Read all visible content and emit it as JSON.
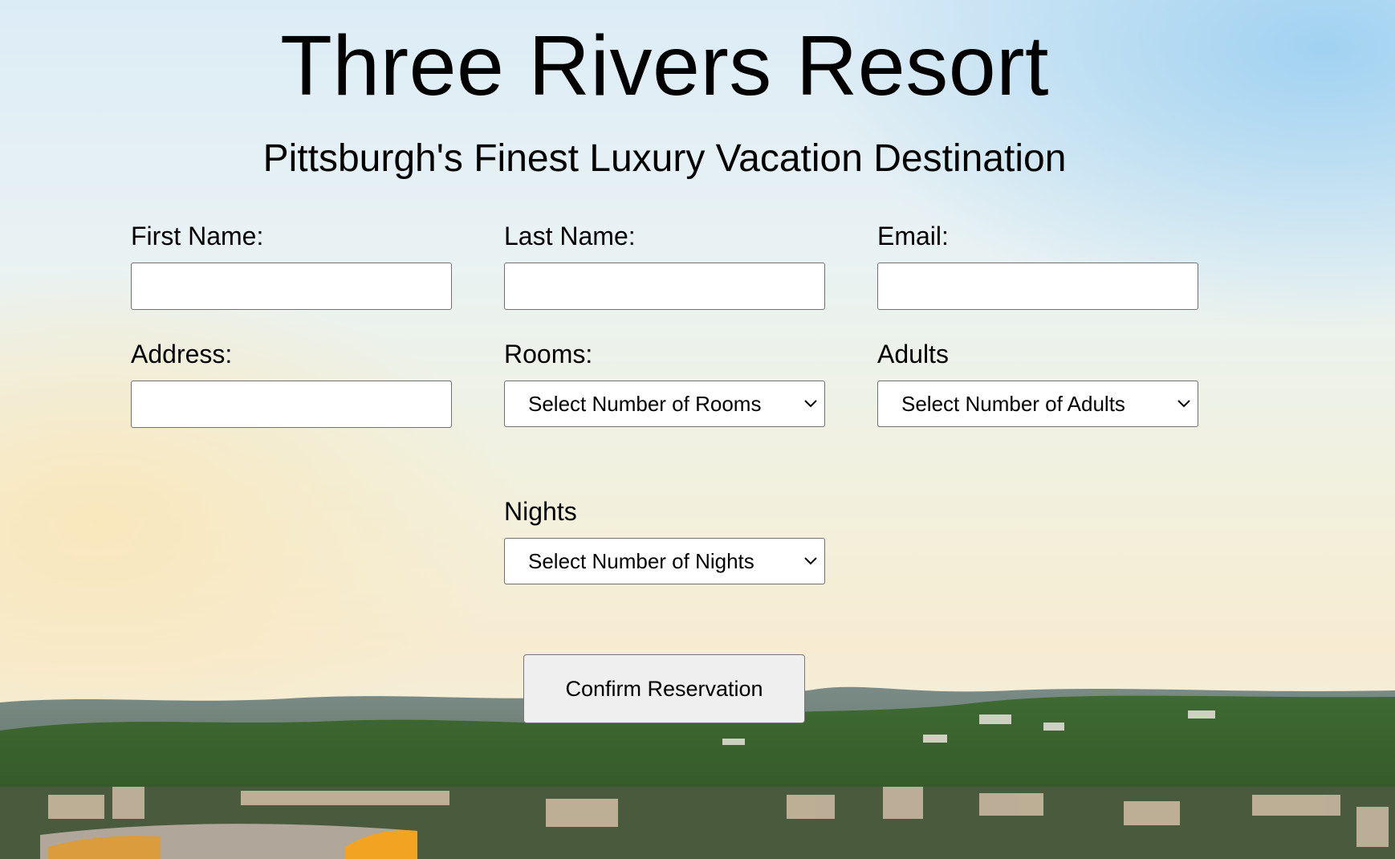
{
  "header": {
    "title": "Three Rivers Resort",
    "subtitle": "Pittsburgh's Finest Luxury Vacation Destination"
  },
  "form": {
    "first_name": {
      "label": "First Name:",
      "value": "",
      "placeholder": ""
    },
    "last_name": {
      "label": "Last Name:",
      "value": "",
      "placeholder": ""
    },
    "email": {
      "label": "Email:",
      "value": "",
      "placeholder": ""
    },
    "address": {
      "label": "Address:",
      "value": "",
      "placeholder": ""
    },
    "rooms": {
      "label": "Rooms:",
      "selected": "Select Number of Rooms"
    },
    "adults": {
      "label": "Adults",
      "selected": "Select Number of Adults"
    },
    "nights": {
      "label": "Nights",
      "selected": "Select Number of Nights"
    },
    "submit_label": "Confirm Reservation"
  },
  "icons": {
    "dropdown": "chevron-down-icon"
  },
  "colors": {
    "sky_top": "#dcecf6",
    "sky_warm": "#f7ecd2",
    "button_bg": "#efefef",
    "field_border": "#707070"
  }
}
